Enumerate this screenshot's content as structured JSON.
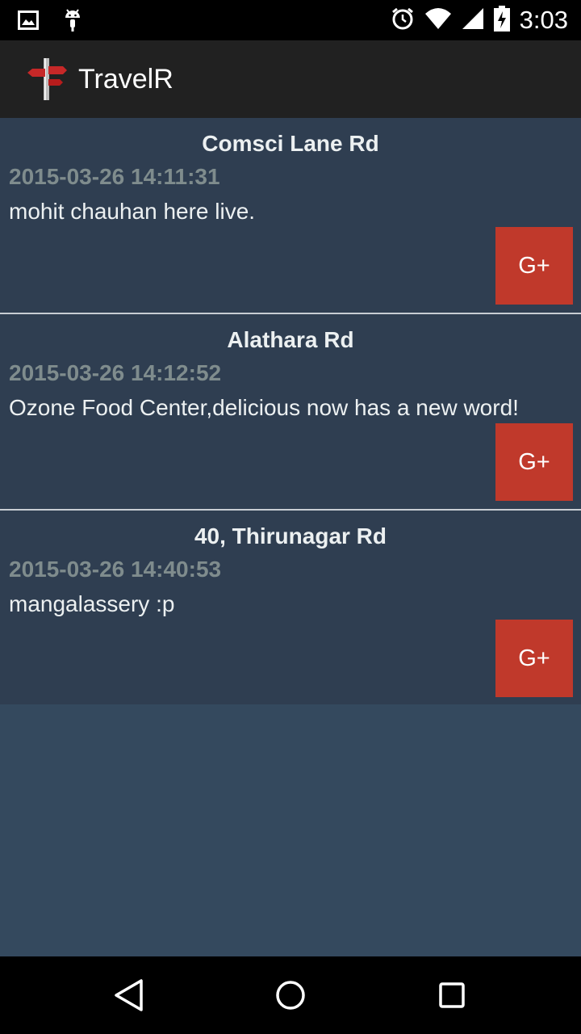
{
  "status_bar": {
    "time": "3:03",
    "icons": [
      "image-notification-icon",
      "android-debug-icon",
      "alarm-icon",
      "wifi-icon",
      "cell-signal-icon",
      "battery-charging-icon"
    ]
  },
  "app_bar": {
    "title": "TravelR",
    "logo": "signpost-logo"
  },
  "posts": [
    {
      "location": "Comsci Lane Rd",
      "timestamp": "2015-03-26 14:11:31",
      "message": "mohit chauhan here live.",
      "share_label": "G+"
    },
    {
      "location": "Alathara Rd",
      "timestamp": "2015-03-26 14:12:52",
      "message": "Ozone Food Center,delicious now has a new word!",
      "share_label": "G+"
    },
    {
      "location": "40, Thirunagar Rd",
      "timestamp": "2015-03-26 14:40:53",
      "message": "mangalassery :p",
      "share_label": "G+"
    }
  ],
  "nav_bar": {
    "buttons": [
      "back-icon",
      "home-icon",
      "recents-icon"
    ]
  },
  "colors": {
    "background": "#34495e",
    "card": "#2f3e51",
    "app_bar": "#212121",
    "share_button": "#c0392b",
    "timestamp": "#7f8c8d"
  }
}
